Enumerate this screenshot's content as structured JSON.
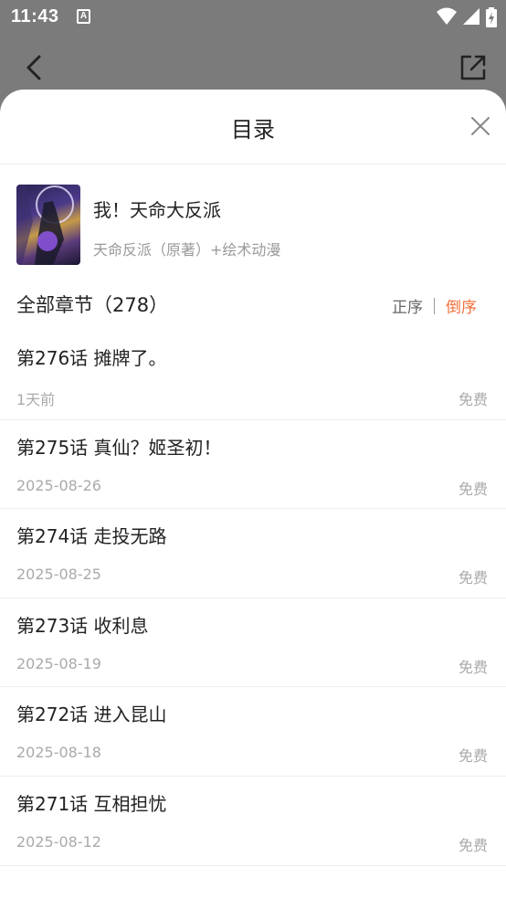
{
  "status_bar": {
    "time": "11:43",
    "notification_glyph": "A",
    "icons": [
      "wifi-icon",
      "signal-icon",
      "battery-charging-icon"
    ]
  },
  "top_bar": {
    "back_icon": "back-arrow-icon",
    "share_icon": "share-icon"
  },
  "sheet": {
    "title": "目录",
    "close_icon": "close-icon"
  },
  "book": {
    "title": "我！天命大反派",
    "author": "天命反派（原著）+绘术动漫"
  },
  "chapters_header": {
    "count_label": "全部章节（278）",
    "sort_asc": "正序",
    "sort_desc": "倒序",
    "active_sort_color": "#f0703c"
  },
  "chapters": [
    {
      "title": "第276话 摊牌了。",
      "date": "1天前",
      "price": "免费"
    },
    {
      "title": "第275话 真仙？姬圣初！",
      "date": "2025-08-26",
      "price": "免费"
    },
    {
      "title": "第274话 走投无路",
      "date": "2025-08-25",
      "price": "免费"
    },
    {
      "title": "第273话 收利息",
      "date": "2025-08-19",
      "price": "免费"
    },
    {
      "title": "第272话 进入昆山",
      "date": "2025-08-18",
      "price": "免费"
    },
    {
      "title": "第271话 互相担忧",
      "date": "2025-08-12",
      "price": "免费"
    }
  ]
}
